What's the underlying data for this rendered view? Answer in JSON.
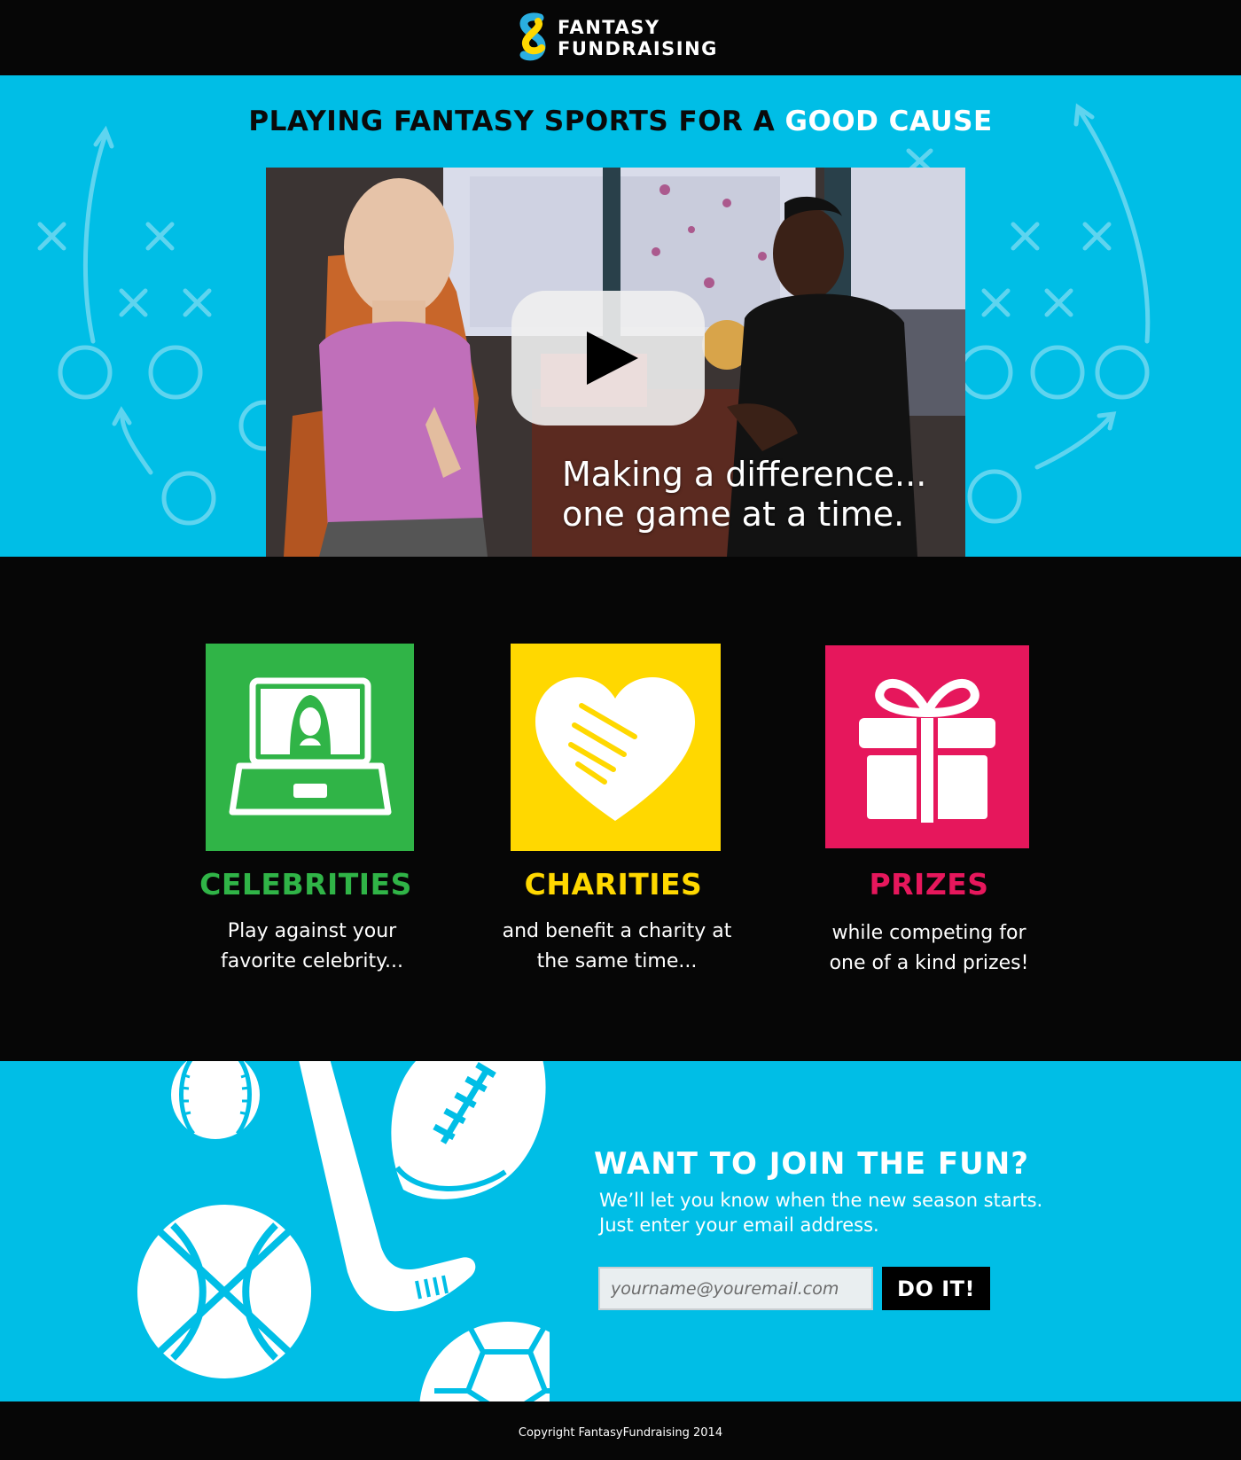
{
  "header": {
    "logo_line1": "FANTASY",
    "logo_line2": "FUNDRAISING"
  },
  "hero": {
    "title_main": "PLAYING FANTASY SPORTS FOR A ",
    "title_highlight": "GOOD CAUSE",
    "video": {
      "caption_line1": "Making a difference...",
      "caption_line2": "one game at a time.",
      "play_icon": "play-icon"
    }
  },
  "features": [
    {
      "title": "CELEBRITIES",
      "desc_line1": "Play against your",
      "desc_line2": "favorite celebrity...",
      "color": "#30b447",
      "icon": "laptop-celebrity-icon"
    },
    {
      "title": "CHARITIES",
      "desc_line1": "and benefit a charity at",
      "desc_line2": "the same time...",
      "color": "#ffd800",
      "icon": "handshake-heart-icon"
    },
    {
      "title": "PRIZES",
      "desc_line1": "while competing for",
      "desc_line2": "one of a kind prizes!",
      "color": "#e6175c",
      "icon": "gift-icon"
    }
  ],
  "signup": {
    "title": "WANT TO JOIN THE FUN?",
    "text_line1": "We’ll let you know when the new season starts.",
    "text_line2": "Just enter your email address.",
    "email_placeholder": "yourname@youremail.com",
    "submit_label": "DO IT!"
  },
  "footer": {
    "copyright": "Copyright FantasyFundraising 2014"
  },
  "colors": {
    "accent_blue": "#00bee6",
    "background_black": "#060606",
    "green": "#30b447",
    "yellow": "#ffd800",
    "pink": "#e6175c"
  }
}
